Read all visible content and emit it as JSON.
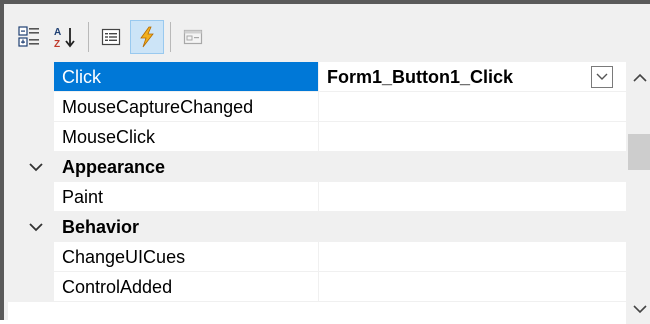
{
  "toolbar": {
    "buttons": [
      {
        "icon": "categorized-icon",
        "checked": false
      },
      {
        "icon": "alphabetical-sort-icon",
        "checked": false
      },
      {
        "icon": "properties-icon",
        "checked": false
      },
      {
        "icon": "events-lightning-icon",
        "checked": true
      },
      {
        "icon": "property-pages-icon",
        "checked": false,
        "disabled": true
      }
    ]
  },
  "grid": {
    "selected_event": "Click",
    "selected_value": "Form1_Button1_Click",
    "rows": [
      {
        "name": "Click",
        "value": "Form1_Button1_Click"
      },
      {
        "name": "MouseCaptureChanged",
        "value": ""
      },
      {
        "name": "MouseClick",
        "value": ""
      },
      {
        "category": "Appearance"
      },
      {
        "name": "Paint",
        "value": ""
      },
      {
        "category": "Behavior"
      },
      {
        "name": "ChangeUICues",
        "value": ""
      },
      {
        "name": "ControlAdded",
        "value": ""
      }
    ]
  },
  "colors": {
    "selection": "#0078d7",
    "toolbar_checked_bg": "#cce4f7",
    "gutter": "#f0f0f0"
  }
}
